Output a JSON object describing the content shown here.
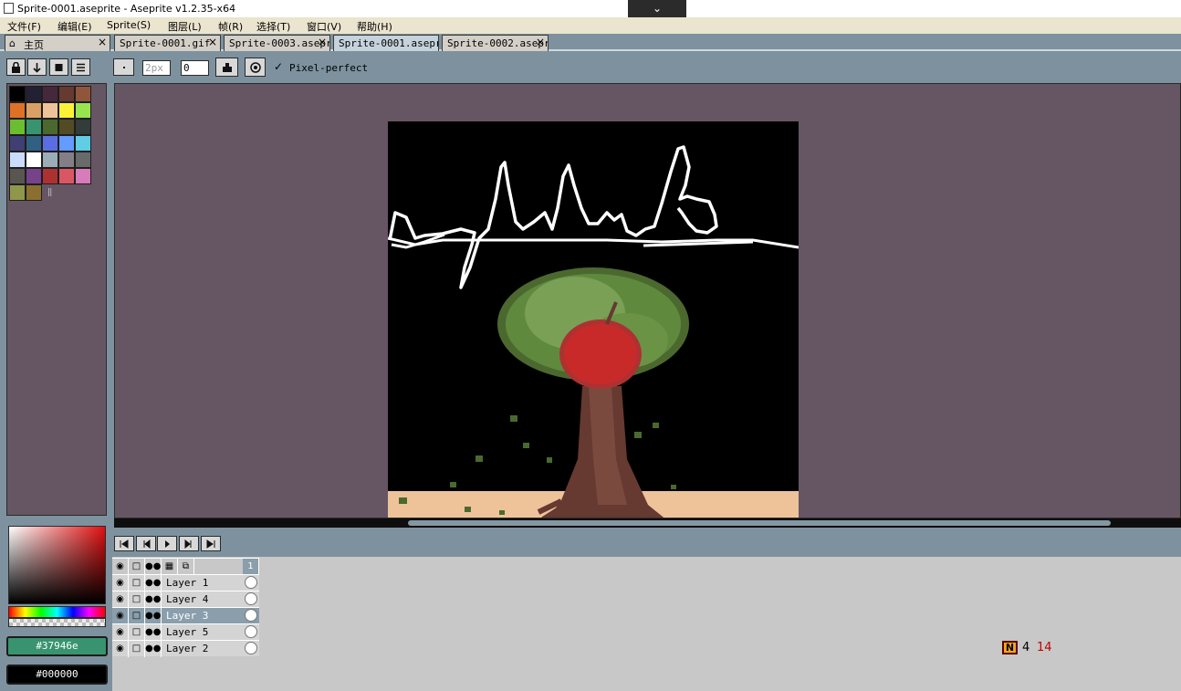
{
  "window": {
    "title": "Sprite-0001.aseprite - Aseprite v1.2.35-x64",
    "collapse_icon": "chevron-down-icon"
  },
  "menu": [
    "文件(F)",
    "编辑(E)",
    "Sprite(S)",
    "图层(L)",
    "帧(R)",
    "选择(T)",
    "窗口(V)",
    "帮助(H)"
  ],
  "tabs": [
    {
      "label": "主页",
      "icon": "home-icon",
      "active": false
    },
    {
      "label": "Sprite-0001.gif",
      "active": false
    },
    {
      "label": "Sprite-0003.aseprite",
      "active": false
    },
    {
      "label": "Sprite-0001.aseprite",
      "active": true
    },
    {
      "label": "Sprite-0002.aseprite",
      "active": false
    }
  ],
  "palette_toolbar": [
    "lock-icon",
    "sort-down-icon",
    "square-icon",
    "menu-icon"
  ],
  "tool_options": {
    "brush_type_icon": "brush-dot-icon",
    "brush_size": "2px",
    "brush_angle": "0",
    "ink_icon": "ink-icon",
    "pixel_perfect_label": "Pixel-perfect",
    "pixel_perfect_checked": true
  },
  "palette": [
    "#000000",
    "#222034",
    "#45283c",
    "#663931",
    "#8f563b",
    "#df7126",
    "#d9a066",
    "#eec39a",
    "#fbf236",
    "#99e550",
    "#6abe30",
    "#37946e",
    "#4b692f",
    "#524b24",
    "#323c39",
    "#3f3f74",
    "#306082",
    "#5b6ee1",
    "#639bff",
    "#5fcde4",
    "#cbdbfc",
    "#ffffff",
    "#9badb7",
    "#847e87",
    "#696a6a",
    "#595652",
    "#76428a",
    "#ac3232",
    "#d95763",
    "#d77bba",
    "#8f974a",
    "#8a6f30"
  ],
  "foreground_color": "#37946e",
  "background_color": "#000000",
  "animation_controls": [
    "first-frame-icon",
    "previous-frame-icon",
    "play-icon",
    "next-frame-icon",
    "last-frame-icon"
  ],
  "timeline": {
    "frame_number": "1",
    "header_icons": [
      "eye-icon",
      "lock-icon",
      "continuous-icon",
      "link-icon",
      "onion-skin-icon"
    ],
    "layers": [
      {
        "name": "Layer 1",
        "selected": false
      },
      {
        "name": "Layer 4",
        "selected": false
      },
      {
        "name": "Layer 3",
        "selected": true
      },
      {
        "name": "Layer 5",
        "selected": false
      },
      {
        "name": "Layer 2",
        "selected": false
      }
    ]
  },
  "status": {
    "icon": "news-icon",
    "icon_letter": "N",
    "value1": "4",
    "value2": "14"
  }
}
